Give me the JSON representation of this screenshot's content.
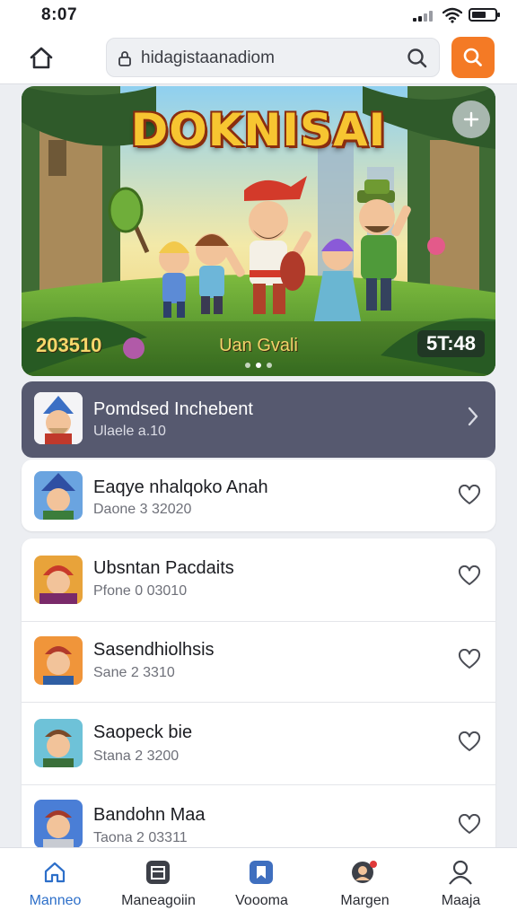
{
  "status": {
    "time": "8:07"
  },
  "topbar": {
    "url": "hidagistaanadiom",
    "icons": {
      "home": "home-icon",
      "lock": "lock-icon",
      "lens": "search-icon",
      "search_button": "search-icon"
    },
    "accent": "#f47a25"
  },
  "banner": {
    "title": "DOKNISAI",
    "caption_left": "203510",
    "caption_center": "Uan Gvali",
    "caption_right": "5T:48",
    "add_icon": "plus-icon",
    "slide_dots": 3,
    "active_dot": 1
  },
  "featured": {
    "name": "Pomdsed Inchebent",
    "sub": "Ulaele a.10",
    "bg": "#56596f",
    "icon": "chevron-right-icon"
  },
  "items": [
    {
      "name": "Eaqye nhalqoko Anah",
      "sub": "Daone 3 32020"
    },
    {
      "name": "Ubsntan Pacdaits",
      "sub": "Pfone 0 03010"
    },
    {
      "name": "Sasendhiolhsis",
      "sub": "Sane 2 3310"
    },
    {
      "name": "Saopeck bie",
      "sub": "Stana 2 3200"
    },
    {
      "name": "Bandohn Maa",
      "sub": "Taona 2 03311"
    }
  ],
  "nav": [
    {
      "label": "Manneo",
      "icon": "home-icon",
      "active": true
    },
    {
      "label": "Maneagoiin",
      "icon": "grid-icon",
      "active": false
    },
    {
      "label": "Voooma",
      "icon": "bookmark-icon",
      "active": false
    },
    {
      "label": "Margen",
      "icon": "chat-icon",
      "active": false
    },
    {
      "label": "Maaja",
      "icon": "profile-icon",
      "active": false
    }
  ],
  "colors": {
    "nav_active": "#2d6fc9",
    "background": "#eceef2"
  }
}
